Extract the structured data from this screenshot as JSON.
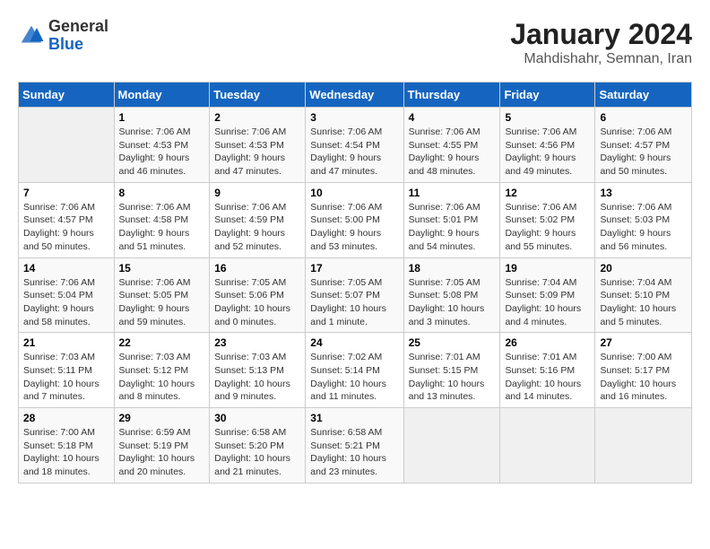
{
  "header": {
    "logo_general": "General",
    "logo_blue": "Blue",
    "month_year": "January 2024",
    "location": "Mahdishahr, Semnan, Iran"
  },
  "days_of_week": [
    "Sunday",
    "Monday",
    "Tuesday",
    "Wednesday",
    "Thursday",
    "Friday",
    "Saturday"
  ],
  "weeks": [
    [
      {
        "day": "",
        "info": ""
      },
      {
        "day": "1",
        "info": "Sunrise: 7:06 AM\nSunset: 4:53 PM\nDaylight: 9 hours\nand 46 minutes."
      },
      {
        "day": "2",
        "info": "Sunrise: 7:06 AM\nSunset: 4:53 PM\nDaylight: 9 hours\nand 47 minutes."
      },
      {
        "day": "3",
        "info": "Sunrise: 7:06 AM\nSunset: 4:54 PM\nDaylight: 9 hours\nand 47 minutes."
      },
      {
        "day": "4",
        "info": "Sunrise: 7:06 AM\nSunset: 4:55 PM\nDaylight: 9 hours\nand 48 minutes."
      },
      {
        "day": "5",
        "info": "Sunrise: 7:06 AM\nSunset: 4:56 PM\nDaylight: 9 hours\nand 49 minutes."
      },
      {
        "day": "6",
        "info": "Sunrise: 7:06 AM\nSunset: 4:57 PM\nDaylight: 9 hours\nand 50 minutes."
      }
    ],
    [
      {
        "day": "7",
        "info": "Sunrise: 7:06 AM\nSunset: 4:57 PM\nDaylight: 9 hours\nand 50 minutes."
      },
      {
        "day": "8",
        "info": "Sunrise: 7:06 AM\nSunset: 4:58 PM\nDaylight: 9 hours\nand 51 minutes."
      },
      {
        "day": "9",
        "info": "Sunrise: 7:06 AM\nSunset: 4:59 PM\nDaylight: 9 hours\nand 52 minutes."
      },
      {
        "day": "10",
        "info": "Sunrise: 7:06 AM\nSunset: 5:00 PM\nDaylight: 9 hours\nand 53 minutes."
      },
      {
        "day": "11",
        "info": "Sunrise: 7:06 AM\nSunset: 5:01 PM\nDaylight: 9 hours\nand 54 minutes."
      },
      {
        "day": "12",
        "info": "Sunrise: 7:06 AM\nSunset: 5:02 PM\nDaylight: 9 hours\nand 55 minutes."
      },
      {
        "day": "13",
        "info": "Sunrise: 7:06 AM\nSunset: 5:03 PM\nDaylight: 9 hours\nand 56 minutes."
      }
    ],
    [
      {
        "day": "14",
        "info": "Sunrise: 7:06 AM\nSunset: 5:04 PM\nDaylight: 9 hours\nand 58 minutes."
      },
      {
        "day": "15",
        "info": "Sunrise: 7:06 AM\nSunset: 5:05 PM\nDaylight: 9 hours\nand 59 minutes."
      },
      {
        "day": "16",
        "info": "Sunrise: 7:05 AM\nSunset: 5:06 PM\nDaylight: 10 hours\nand 0 minutes."
      },
      {
        "day": "17",
        "info": "Sunrise: 7:05 AM\nSunset: 5:07 PM\nDaylight: 10 hours\nand 1 minute."
      },
      {
        "day": "18",
        "info": "Sunrise: 7:05 AM\nSunset: 5:08 PM\nDaylight: 10 hours\nand 3 minutes."
      },
      {
        "day": "19",
        "info": "Sunrise: 7:04 AM\nSunset: 5:09 PM\nDaylight: 10 hours\nand 4 minutes."
      },
      {
        "day": "20",
        "info": "Sunrise: 7:04 AM\nSunset: 5:10 PM\nDaylight: 10 hours\nand 5 minutes."
      }
    ],
    [
      {
        "day": "21",
        "info": "Sunrise: 7:03 AM\nSunset: 5:11 PM\nDaylight: 10 hours\nand 7 minutes."
      },
      {
        "day": "22",
        "info": "Sunrise: 7:03 AM\nSunset: 5:12 PM\nDaylight: 10 hours\nand 8 minutes."
      },
      {
        "day": "23",
        "info": "Sunrise: 7:03 AM\nSunset: 5:13 PM\nDaylight: 10 hours\nand 9 minutes."
      },
      {
        "day": "24",
        "info": "Sunrise: 7:02 AM\nSunset: 5:14 PM\nDaylight: 10 hours\nand 11 minutes."
      },
      {
        "day": "25",
        "info": "Sunrise: 7:01 AM\nSunset: 5:15 PM\nDaylight: 10 hours\nand 13 minutes."
      },
      {
        "day": "26",
        "info": "Sunrise: 7:01 AM\nSunset: 5:16 PM\nDaylight: 10 hours\nand 14 minutes."
      },
      {
        "day": "27",
        "info": "Sunrise: 7:00 AM\nSunset: 5:17 PM\nDaylight: 10 hours\nand 16 minutes."
      }
    ],
    [
      {
        "day": "28",
        "info": "Sunrise: 7:00 AM\nSunset: 5:18 PM\nDaylight: 10 hours\nand 18 minutes."
      },
      {
        "day": "29",
        "info": "Sunrise: 6:59 AM\nSunset: 5:19 PM\nDaylight: 10 hours\nand 20 minutes."
      },
      {
        "day": "30",
        "info": "Sunrise: 6:58 AM\nSunset: 5:20 PM\nDaylight: 10 hours\nand 21 minutes."
      },
      {
        "day": "31",
        "info": "Sunrise: 6:58 AM\nSunset: 5:21 PM\nDaylight: 10 hours\nand 23 minutes."
      },
      {
        "day": "",
        "info": ""
      },
      {
        "day": "",
        "info": ""
      },
      {
        "day": "",
        "info": ""
      }
    ]
  ]
}
